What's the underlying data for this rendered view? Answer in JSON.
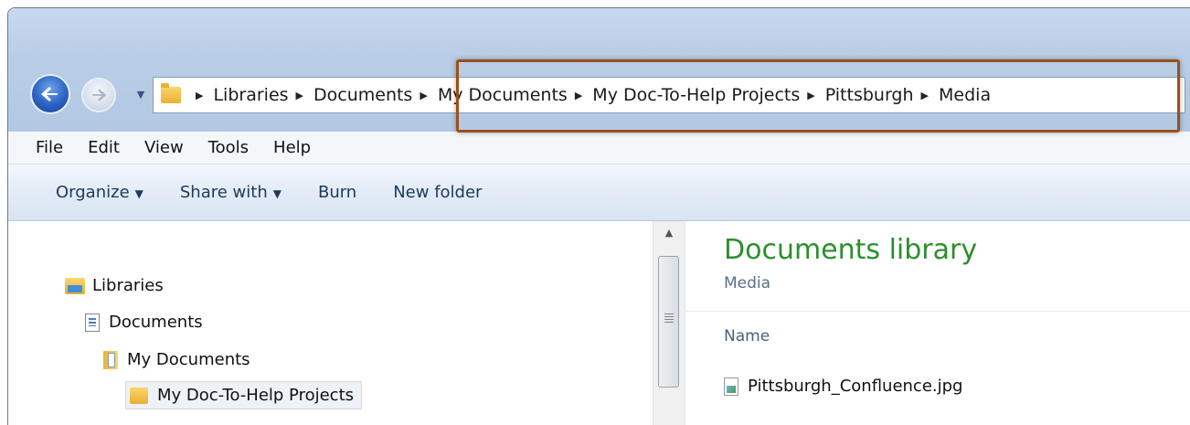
{
  "breadcrumb": {
    "items": [
      "Libraries",
      "Documents",
      "My Documents",
      "My Doc-To-Help Projects",
      "Pittsburgh",
      "Media"
    ]
  },
  "menu": [
    "File",
    "Edit",
    "View",
    "Tools",
    "Help"
  ],
  "toolbar": {
    "organize": "Organize",
    "share_with": "Share with",
    "burn": "Burn",
    "new_folder": "New folder"
  },
  "nav_tree": {
    "libraries": "Libraries",
    "documents": "Documents",
    "my_documents": "My Documents",
    "my_doc_to_help_projects": "My Doc-To-Help Projects"
  },
  "content": {
    "title": "Documents library",
    "subtitle": "Media",
    "column_name": "Name",
    "files": [
      "Pittsburgh_Confluence.jpg"
    ]
  },
  "colors": {
    "highlight_border": "#9c4f1a",
    "library_title": "#2c8f2c"
  }
}
